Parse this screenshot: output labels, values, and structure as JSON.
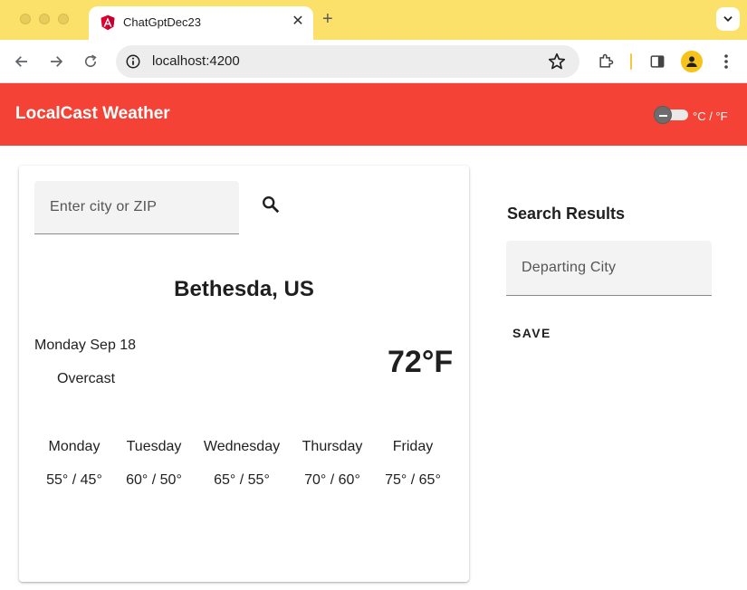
{
  "browser": {
    "tab_title": "ChatGptDec23",
    "new_tab_symbol": "+",
    "close_symbol": "✕",
    "url": "localhost:4200"
  },
  "app": {
    "title": "LocalCast Weather",
    "unit_toggle_label": "°C / °F",
    "colors": {
      "header": "#f44336",
      "browser_titlebar": "#fbe06a"
    }
  },
  "search": {
    "placeholder": "Enter city or ZIP"
  },
  "current": {
    "city": "Bethesda, US",
    "date": "Monday Sep 18",
    "condition": "Overcast",
    "temperature": "72°F"
  },
  "forecast": [
    {
      "day": "Monday",
      "range": "55° / 45°"
    },
    {
      "day": "Tuesday",
      "range": "60° / 50°"
    },
    {
      "day": "Wednesday",
      "range": "65° / 55°"
    },
    {
      "day": "Thursday",
      "range": "70° / 60°"
    },
    {
      "day": "Friday",
      "range": "75° / 65°"
    }
  ],
  "results": {
    "title": "Search Results",
    "departing_placeholder": "Departing City",
    "save_label": "SAVE"
  }
}
